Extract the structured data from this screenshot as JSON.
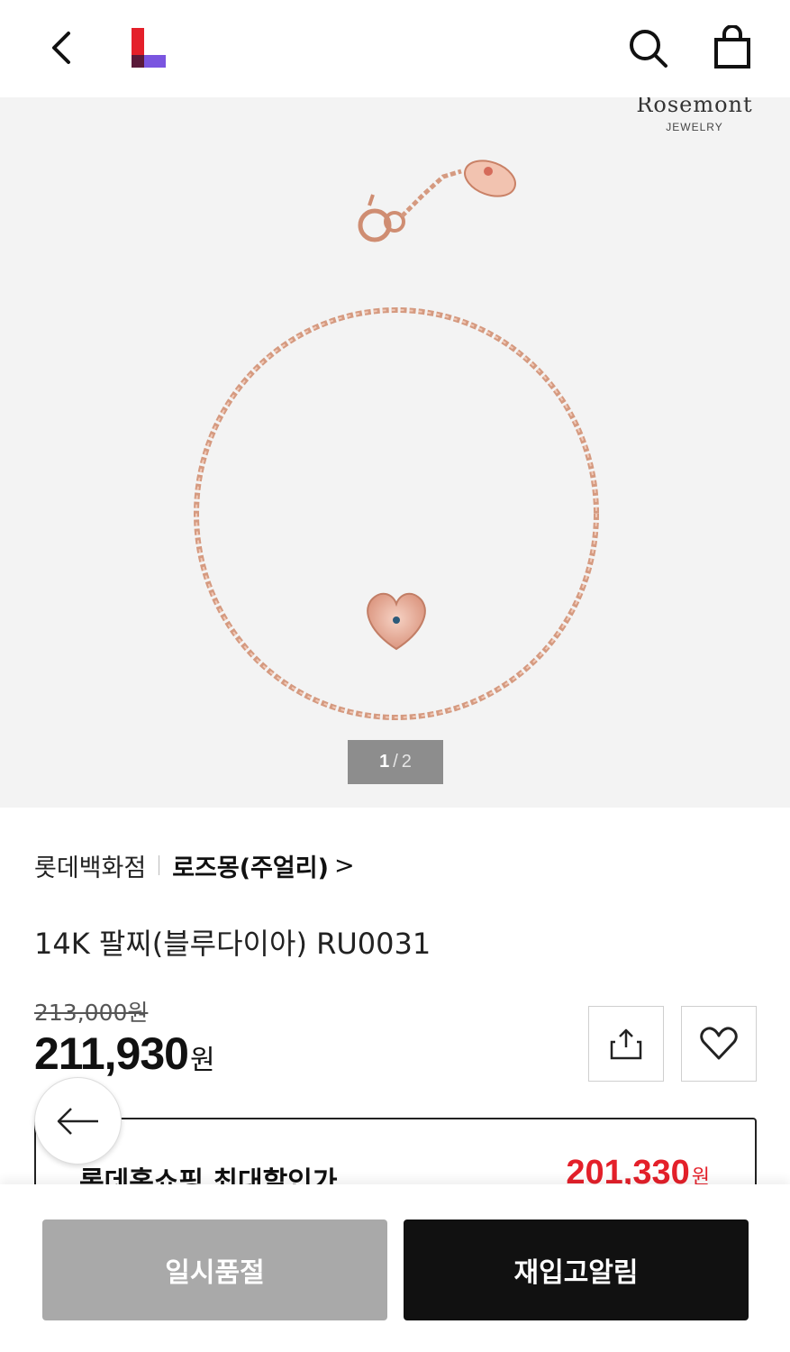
{
  "header": {
    "back_icon": "chevron-left-icon",
    "logo": "lotte-on-logo",
    "search_icon": "search-icon",
    "cart_icon": "shopping-bag-icon"
  },
  "gallery": {
    "brand_name": "Rosemont",
    "brand_sub": "JEWELRY",
    "current": "1",
    "separator": "/",
    "total": "2"
  },
  "product": {
    "store": "롯데백화점",
    "brand": "로즈몽(주얼리)",
    "brand_chevron": ">",
    "title": "14K 팔찌(블루다이아) RU0031",
    "original_price": "213,000원",
    "sale_price": "211,930",
    "currency": "원"
  },
  "actions": {
    "share_icon": "share-icon",
    "wish_icon": "heart-icon"
  },
  "promo": {
    "label": "롯데홈쇼핑 최대할인가",
    "price": "201,330",
    "currency": "원"
  },
  "bottom": {
    "soldout_label": "일시품절",
    "restock_label": "재입고알림"
  },
  "colors": {
    "accent_red": "#e4202a",
    "logo_red": "#e4202a",
    "logo_purple": "#7a55e0",
    "gallery_bg": "#f3f3f3"
  }
}
